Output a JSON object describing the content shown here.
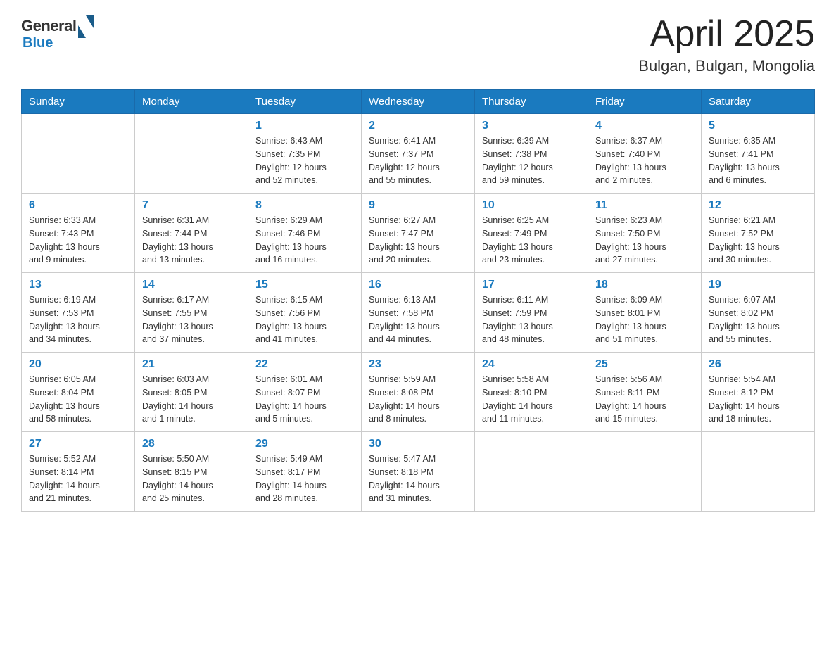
{
  "header": {
    "logo": {
      "general": "General",
      "blue": "Blue"
    },
    "title": "April 2025",
    "location": "Bulgan, Bulgan, Mongolia"
  },
  "weekdays": [
    "Sunday",
    "Monday",
    "Tuesday",
    "Wednesday",
    "Thursday",
    "Friday",
    "Saturday"
  ],
  "weeks": [
    [
      {
        "day": "",
        "info": ""
      },
      {
        "day": "",
        "info": ""
      },
      {
        "day": "1",
        "info": "Sunrise: 6:43 AM\nSunset: 7:35 PM\nDaylight: 12 hours\nand 52 minutes."
      },
      {
        "day": "2",
        "info": "Sunrise: 6:41 AM\nSunset: 7:37 PM\nDaylight: 12 hours\nand 55 minutes."
      },
      {
        "day": "3",
        "info": "Sunrise: 6:39 AM\nSunset: 7:38 PM\nDaylight: 12 hours\nand 59 minutes."
      },
      {
        "day": "4",
        "info": "Sunrise: 6:37 AM\nSunset: 7:40 PM\nDaylight: 13 hours\nand 2 minutes."
      },
      {
        "day": "5",
        "info": "Sunrise: 6:35 AM\nSunset: 7:41 PM\nDaylight: 13 hours\nand 6 minutes."
      }
    ],
    [
      {
        "day": "6",
        "info": "Sunrise: 6:33 AM\nSunset: 7:43 PM\nDaylight: 13 hours\nand 9 minutes."
      },
      {
        "day": "7",
        "info": "Sunrise: 6:31 AM\nSunset: 7:44 PM\nDaylight: 13 hours\nand 13 minutes."
      },
      {
        "day": "8",
        "info": "Sunrise: 6:29 AM\nSunset: 7:46 PM\nDaylight: 13 hours\nand 16 minutes."
      },
      {
        "day": "9",
        "info": "Sunrise: 6:27 AM\nSunset: 7:47 PM\nDaylight: 13 hours\nand 20 minutes."
      },
      {
        "day": "10",
        "info": "Sunrise: 6:25 AM\nSunset: 7:49 PM\nDaylight: 13 hours\nand 23 minutes."
      },
      {
        "day": "11",
        "info": "Sunrise: 6:23 AM\nSunset: 7:50 PM\nDaylight: 13 hours\nand 27 minutes."
      },
      {
        "day": "12",
        "info": "Sunrise: 6:21 AM\nSunset: 7:52 PM\nDaylight: 13 hours\nand 30 minutes."
      }
    ],
    [
      {
        "day": "13",
        "info": "Sunrise: 6:19 AM\nSunset: 7:53 PM\nDaylight: 13 hours\nand 34 minutes."
      },
      {
        "day": "14",
        "info": "Sunrise: 6:17 AM\nSunset: 7:55 PM\nDaylight: 13 hours\nand 37 minutes."
      },
      {
        "day": "15",
        "info": "Sunrise: 6:15 AM\nSunset: 7:56 PM\nDaylight: 13 hours\nand 41 minutes."
      },
      {
        "day": "16",
        "info": "Sunrise: 6:13 AM\nSunset: 7:58 PM\nDaylight: 13 hours\nand 44 minutes."
      },
      {
        "day": "17",
        "info": "Sunrise: 6:11 AM\nSunset: 7:59 PM\nDaylight: 13 hours\nand 48 minutes."
      },
      {
        "day": "18",
        "info": "Sunrise: 6:09 AM\nSunset: 8:01 PM\nDaylight: 13 hours\nand 51 minutes."
      },
      {
        "day": "19",
        "info": "Sunrise: 6:07 AM\nSunset: 8:02 PM\nDaylight: 13 hours\nand 55 minutes."
      }
    ],
    [
      {
        "day": "20",
        "info": "Sunrise: 6:05 AM\nSunset: 8:04 PM\nDaylight: 13 hours\nand 58 minutes."
      },
      {
        "day": "21",
        "info": "Sunrise: 6:03 AM\nSunset: 8:05 PM\nDaylight: 14 hours\nand 1 minute."
      },
      {
        "day": "22",
        "info": "Sunrise: 6:01 AM\nSunset: 8:07 PM\nDaylight: 14 hours\nand 5 minutes."
      },
      {
        "day": "23",
        "info": "Sunrise: 5:59 AM\nSunset: 8:08 PM\nDaylight: 14 hours\nand 8 minutes."
      },
      {
        "day": "24",
        "info": "Sunrise: 5:58 AM\nSunset: 8:10 PM\nDaylight: 14 hours\nand 11 minutes."
      },
      {
        "day": "25",
        "info": "Sunrise: 5:56 AM\nSunset: 8:11 PM\nDaylight: 14 hours\nand 15 minutes."
      },
      {
        "day": "26",
        "info": "Sunrise: 5:54 AM\nSunset: 8:12 PM\nDaylight: 14 hours\nand 18 minutes."
      }
    ],
    [
      {
        "day": "27",
        "info": "Sunrise: 5:52 AM\nSunset: 8:14 PM\nDaylight: 14 hours\nand 21 minutes."
      },
      {
        "day": "28",
        "info": "Sunrise: 5:50 AM\nSunset: 8:15 PM\nDaylight: 14 hours\nand 25 minutes."
      },
      {
        "day": "29",
        "info": "Sunrise: 5:49 AM\nSunset: 8:17 PM\nDaylight: 14 hours\nand 28 minutes."
      },
      {
        "day": "30",
        "info": "Sunrise: 5:47 AM\nSunset: 8:18 PM\nDaylight: 14 hours\nand 31 minutes."
      },
      {
        "day": "",
        "info": ""
      },
      {
        "day": "",
        "info": ""
      },
      {
        "day": "",
        "info": ""
      }
    ]
  ]
}
